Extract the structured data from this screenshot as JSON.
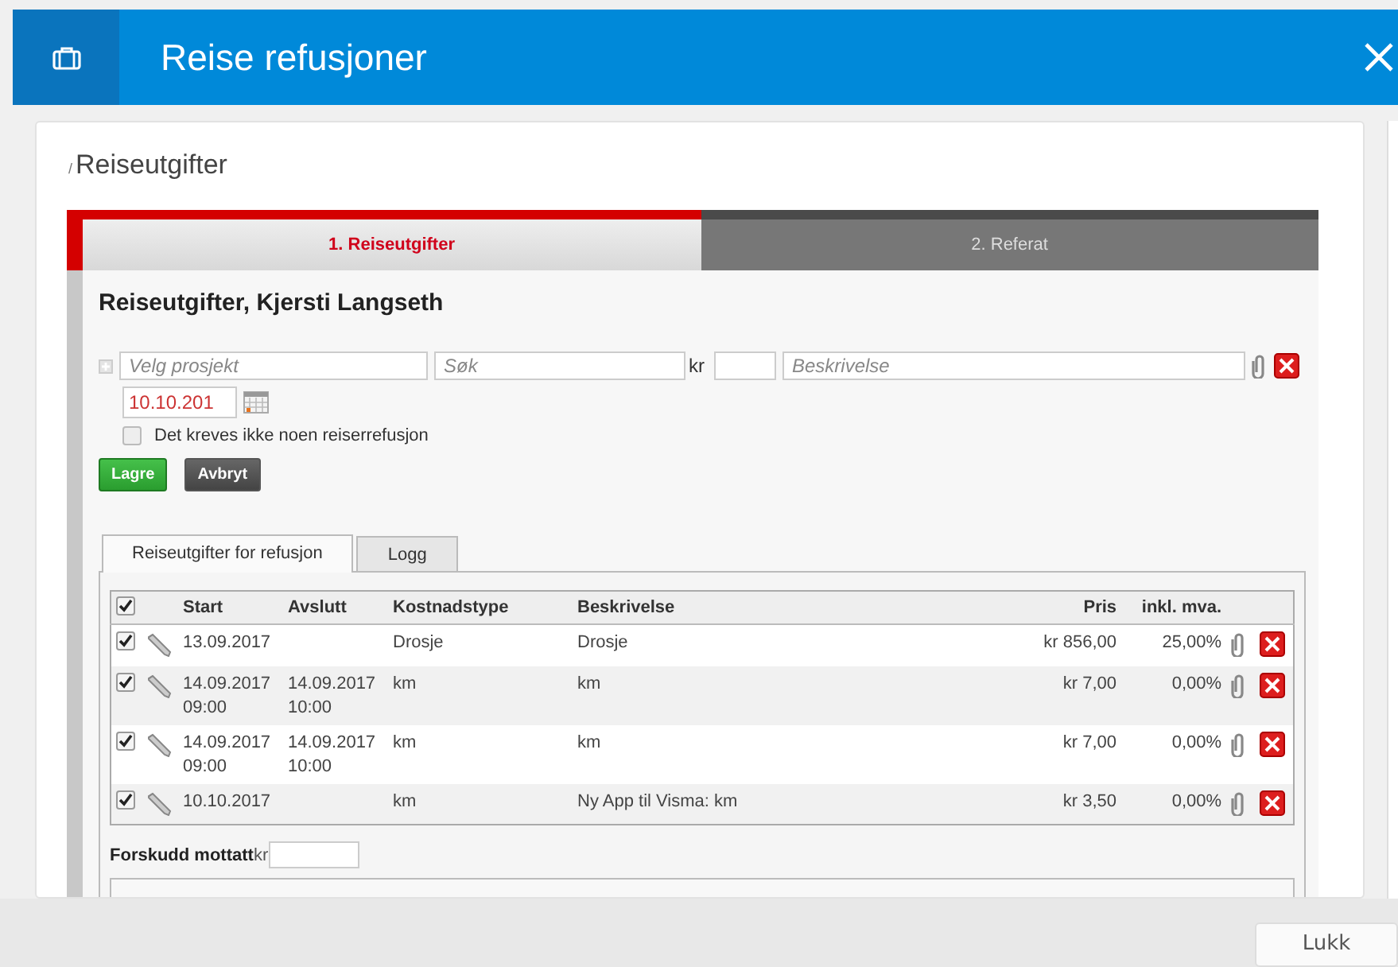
{
  "window": {
    "title": "Reise refusjoner"
  },
  "breadcrumb": {
    "separator": "/",
    "label": "Reiseutgifter"
  },
  "steps": [
    {
      "label": "1. Reiseutgifter",
      "selected": true
    },
    {
      "label": "2. Referat",
      "selected": false
    }
  ],
  "form": {
    "heading": "Reiseutgifter, Kjersti Langseth",
    "project_placeholder": "Velg prosjekt",
    "search_placeholder": "Søk",
    "currency": "kr",
    "description_placeholder": "Beskrivelse",
    "date": "10.10.201",
    "no_refund": {
      "label": "Det kreves ikke noen reiserrefusjon",
      "checked": false
    },
    "buttons": [
      {
        "label": "Lagre",
        "kind": "primary"
      },
      {
        "label": "Avbryt",
        "kind": "secondary"
      }
    ]
  },
  "tabs": [
    {
      "label": "Reiseutgifter for refusjon",
      "selected": true
    },
    {
      "label": "Logg",
      "selected": false
    }
  ],
  "table": {
    "all_checked": true,
    "columns": [
      "Start",
      "Avslutt",
      "Kostnadstype",
      "Beskrivelse",
      "Pris",
      "inkl. mva."
    ],
    "rows": [
      {
        "checked": true,
        "start": "13.09.2017",
        "end": "",
        "type": "Drosje",
        "description": "Drosje",
        "price": "kr 856,00",
        "vat": "25,00%"
      },
      {
        "checked": true,
        "start": "14.09.2017\n09:00",
        "end": "14.09.2017\n10:00",
        "type": "km",
        "description": "km",
        "price": "kr 7,00",
        "vat": "0,00%"
      },
      {
        "checked": true,
        "start": "14.09.2017\n09:00",
        "end": "14.09.2017\n10:00",
        "type": "km",
        "description": "km",
        "price": "kr 7,00",
        "vat": "0,00%"
      },
      {
        "checked": true,
        "start": "10.10.2017",
        "end": "",
        "type": "km",
        "description": "Ny App til Visma: km",
        "price": "kr 3,50",
        "vat": "0,00%"
      }
    ]
  },
  "advance": {
    "label": "Forskudd mottatt",
    "currency": "kr"
  },
  "footer": {
    "button": "Lukk"
  }
}
